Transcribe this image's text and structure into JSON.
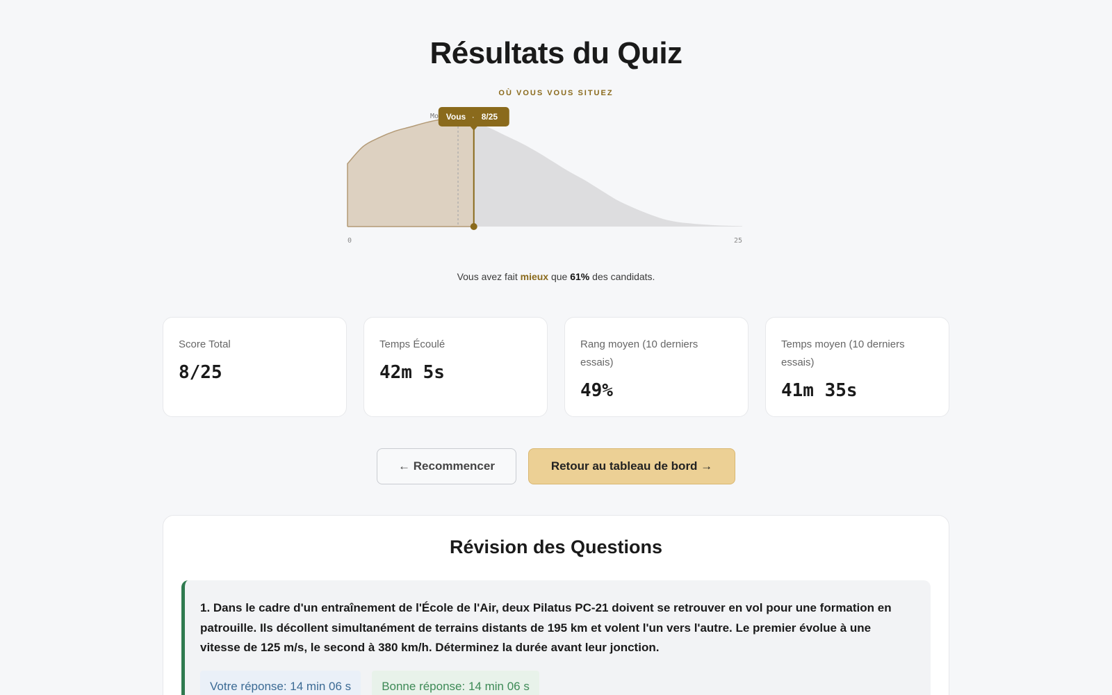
{
  "header": {
    "title": "Résultats du Quiz",
    "kicker": "OÙ VOUS VOUS SITUEZ"
  },
  "chart_data": {
    "type": "area",
    "x": [
      0,
      1,
      2,
      3,
      4,
      5,
      6,
      7,
      8,
      9,
      10,
      11,
      12,
      13,
      14,
      15,
      16,
      17,
      18,
      19,
      20,
      21,
      22,
      23,
      24,
      25
    ],
    "density": [
      0.58,
      0.74,
      0.82,
      0.88,
      0.92,
      0.96,
      0.99,
      1.0,
      0.97,
      0.91,
      0.84,
      0.77,
      0.69,
      0.6,
      0.51,
      0.43,
      0.34,
      0.25,
      0.18,
      0.12,
      0.07,
      0.04,
      0.025,
      0.015,
      0.008,
      0.004
    ],
    "xlim": [
      0,
      25
    ],
    "x_tick_labels": [
      "0",
      "25"
    ],
    "mean_marker_label": "Moy.",
    "mean_score": 7,
    "user_score": 8,
    "user_label": "Vous",
    "user_value_label": "8/25",
    "colors": {
      "below": "#ddd1c1",
      "below_line": "#b39a76",
      "above": "#dddddf",
      "marker": "#8a6a1c",
      "mean_line": "#a9a9a9"
    }
  },
  "summary": {
    "prefix": "Vous avez fait ",
    "highlight": "mieux",
    "middle": " que ",
    "percent": "61%",
    "suffix": " des candidats."
  },
  "stats": [
    {
      "label": "Score Total",
      "value": "8/25"
    },
    {
      "label": "Temps Écoulé",
      "value": "42m 5s"
    },
    {
      "label": "Rang moyen (10 derniers essais)",
      "value": "49%"
    },
    {
      "label": "Temps moyen (10 derniers essais)",
      "value": "41m 35s"
    }
  ],
  "actions": {
    "restart_label": "← Recommencer",
    "dashboard_label": "Retour au tableau de bord →"
  },
  "review": {
    "title": "Révision des Questions",
    "questions": [
      {
        "text": "1. Dans le cadre d'un entraînement de l'École de l'Air, deux Pilatus PC-21 doivent se retrouver en vol pour une formation en patrouille. Ils décollent simultanément de terrains distants de 195 km et volent l'un vers l'autre. Le premier évolue à une vitesse de 125 m/s, le second à 380 km/h. Déterminez la durée avant leur jonction.",
        "user_answer": "Votre réponse: 14 min 06 s",
        "correct_answer": "Bonne réponse: 14 min 06 s"
      }
    ]
  }
}
